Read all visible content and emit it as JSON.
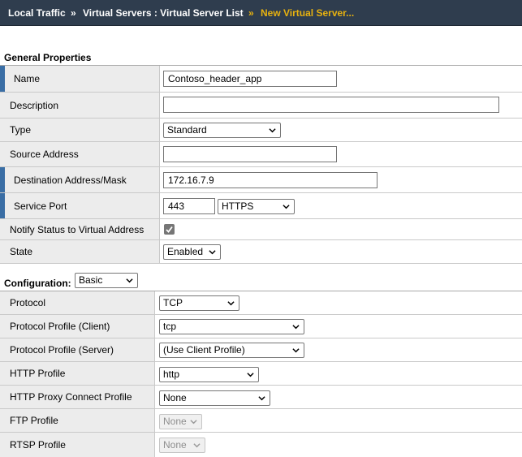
{
  "breadcrumb": {
    "items": [
      "Local Traffic",
      "Virtual Servers : Virtual Server List",
      "New Virtual Server..."
    ],
    "separator": "»"
  },
  "general": {
    "title": "General Properties",
    "name_label": "Name",
    "name_value": "Contoso_header_app",
    "description_label": "Description",
    "description_value": "",
    "type_label": "Type",
    "type_value": "Standard",
    "source_label": "Source Address",
    "source_value": "",
    "destination_label": "Destination Address/Mask",
    "destination_value": "172.16.7.9",
    "service_port_label": "Service Port",
    "service_port_value": "443",
    "service_port_select": "HTTPS",
    "notify_label": "Notify Status to Virtual Address",
    "notify_checked": true,
    "state_label": "State",
    "state_value": "Enabled"
  },
  "configuration": {
    "title": "Configuration:",
    "mode_value": "Basic",
    "protocol_label": "Protocol",
    "protocol_value": "TCP",
    "profile_client_label": "Protocol Profile (Client)",
    "profile_client_value": "tcp",
    "profile_server_label": "Protocol Profile (Server)",
    "profile_server_value": "(Use Client Profile)",
    "http_profile_label": "HTTP Profile",
    "http_profile_value": "http",
    "http_proxy_label": "HTTP Proxy Connect Profile",
    "http_proxy_value": "None",
    "ftp_profile_label": "FTP Profile",
    "ftp_profile_value": "None",
    "rtsp_profile_label": "RTSP Profile",
    "rtsp_profile_value": "None"
  },
  "colors": {
    "breadcrumb_bg": "#2f3d4e",
    "breadcrumb_current": "#e8b20f",
    "required_marker": "#3a6ea5",
    "label_bg": "#ececec"
  }
}
